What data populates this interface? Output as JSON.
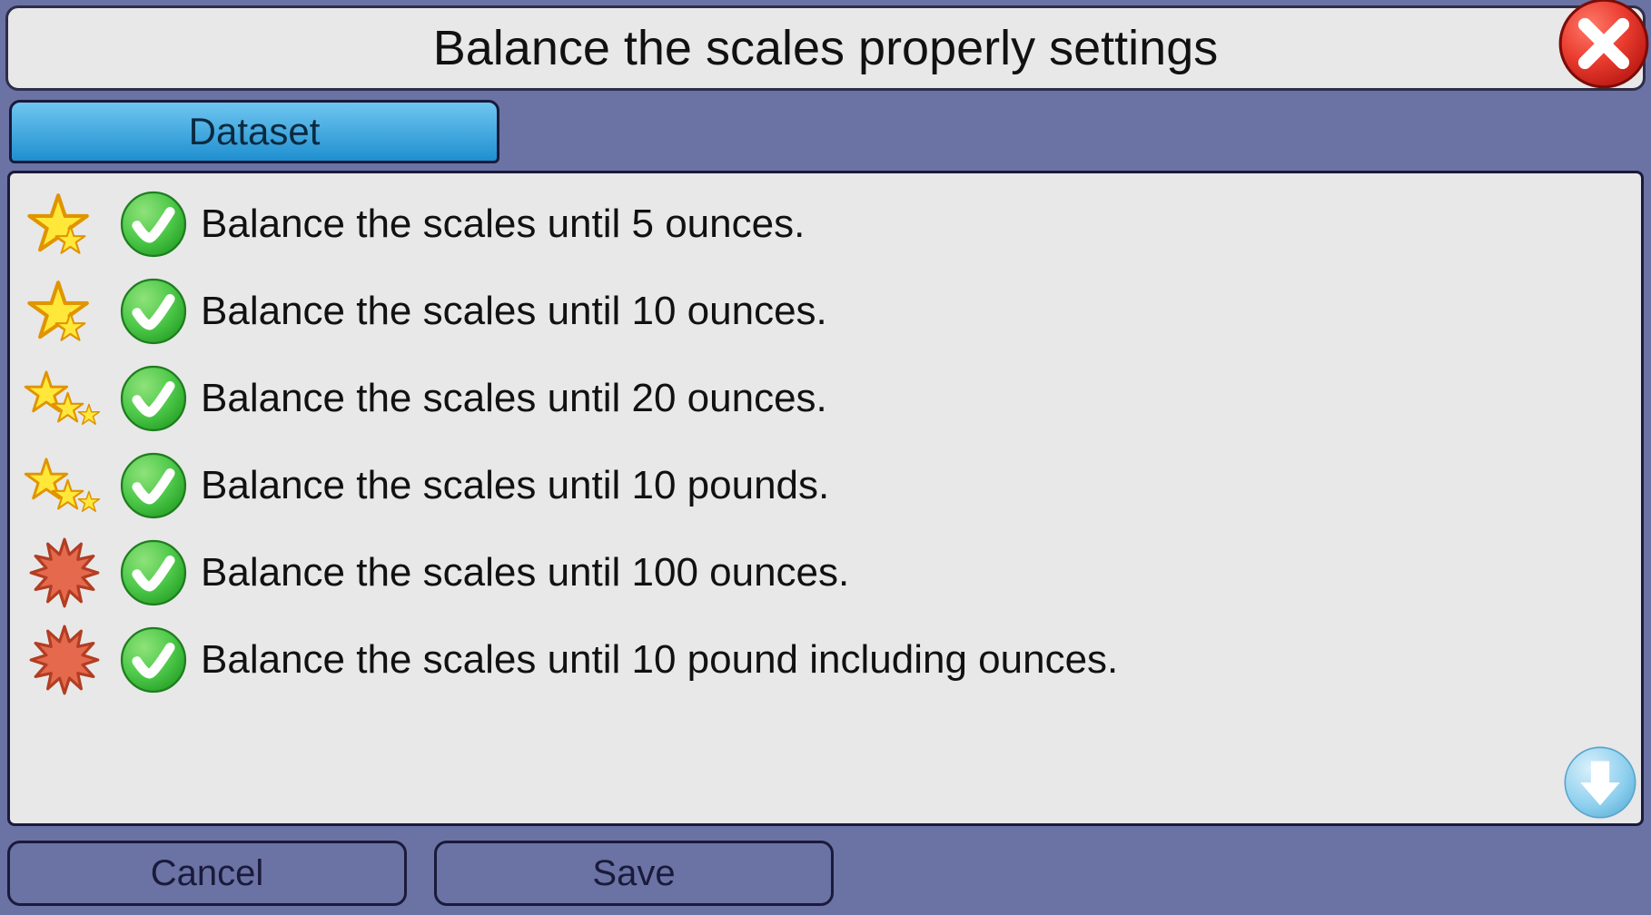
{
  "header": {
    "title": "Balance the scales properly settings"
  },
  "tabs": [
    {
      "label": "Dataset"
    }
  ],
  "items": [
    {
      "difficulty": "one-star",
      "checked": true,
      "label": "Balance the scales until 5 ounces."
    },
    {
      "difficulty": "one-star",
      "checked": true,
      "label": "Balance the scales until 10 ounces."
    },
    {
      "difficulty": "two-star",
      "checked": true,
      "label": "Balance the scales until 20 ounces."
    },
    {
      "difficulty": "two-star",
      "checked": true,
      "label": "Balance the scales until 10 pounds."
    },
    {
      "difficulty": "sun",
      "checked": true,
      "label": "Balance the scales until 100 ounces."
    },
    {
      "difficulty": "sun",
      "checked": true,
      "label": "Balance the scales until 10 pound including ounces."
    }
  ],
  "footer": {
    "cancel": "Cancel",
    "save": "Save"
  }
}
